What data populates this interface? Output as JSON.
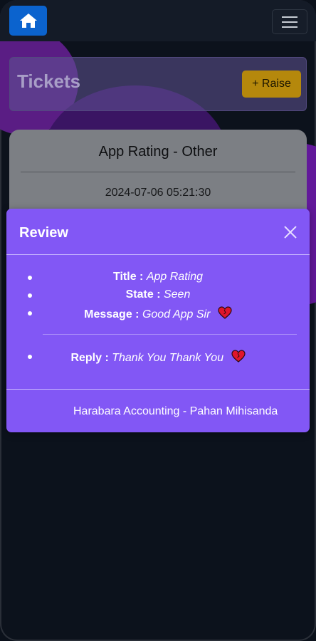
{
  "nav": {
    "home_icon": "home-icon",
    "menu_icon": "hamburger-icon"
  },
  "header": {
    "title": "Tickets",
    "raise_label": "+ Raise"
  },
  "ticket": {
    "title": "App Rating - Other",
    "date": "2024-07-06 05:21:30"
  },
  "modal": {
    "title": "Review",
    "close_icon": "close-icon",
    "items": [
      {
        "label": "Title :",
        "value": "App Rating"
      },
      {
        "label": "State :",
        "value": "Seen"
      },
      {
        "label": "Message :",
        "value": "Good App Sir"
      }
    ],
    "reply": {
      "label": "Reply :",
      "value": "Thank You Thank You"
    },
    "footer": "Harabara Accounting - Pahan Mihisanda"
  },
  "colors": {
    "accent": "#8257f5",
    "home_button": "#0b63ce",
    "raise_button": "#b5880c"
  }
}
